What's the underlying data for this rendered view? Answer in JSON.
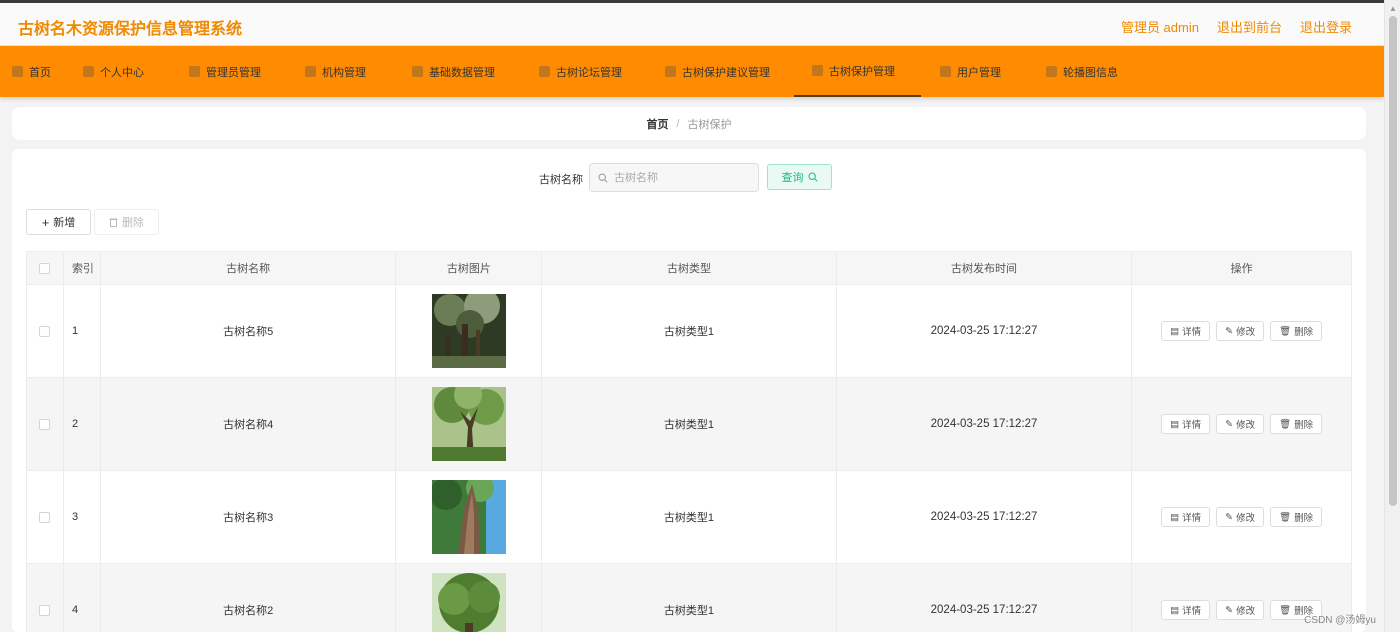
{
  "header": {
    "title": "古树名木资源保护信息管理系统",
    "admin_label": "管理员 admin",
    "front_label": "退出到前台",
    "logout_label": "退出登录"
  },
  "nav": {
    "items": [
      {
        "label": "首页",
        "icon": "home-icon"
      },
      {
        "label": "个人中心",
        "icon": "user-icon"
      },
      {
        "label": "管理员管理",
        "icon": "admin-icon"
      },
      {
        "label": "机构管理",
        "icon": "building-icon"
      },
      {
        "label": "基础数据管理",
        "icon": "data-icon"
      },
      {
        "label": "古树论坛管理",
        "icon": "forum-icon"
      },
      {
        "label": "古树保护建议管理",
        "icon": "suggest-icon"
      },
      {
        "label": "古树保护管理",
        "icon": "protect-icon"
      },
      {
        "label": "用户管理",
        "icon": "users-icon"
      },
      {
        "label": "轮播图信息",
        "icon": "carousel-icon"
      }
    ],
    "active_index": 7
  },
  "breadcrumb": {
    "home": "首页",
    "separator": "/",
    "current": "古树保护"
  },
  "search": {
    "label": "古树名称",
    "placeholder": "古树名称",
    "button": "查询"
  },
  "actions": {
    "add": "新增",
    "delete": "删除"
  },
  "table": {
    "headers": {
      "index": "索引",
      "name": "古树名称",
      "image": "古树图片",
      "type": "古树类型",
      "time": "古树发布时间",
      "ops": "操作"
    },
    "rows": [
      {
        "index": "1",
        "name": "古树名称5",
        "type": "古树类型1",
        "time": "2024-03-25 17:12:27"
      },
      {
        "index": "2",
        "name": "古树名称4",
        "type": "古树类型1",
        "time": "2024-03-25 17:12:27"
      },
      {
        "index": "3",
        "name": "古树名称3",
        "type": "古树类型1",
        "time": "2024-03-25 17:12:27"
      },
      {
        "index": "4",
        "name": "古树名称2",
        "type": "古树类型1",
        "time": "2024-03-25 17:12:27"
      }
    ],
    "op_labels": {
      "detail": "详情",
      "edit": "修改",
      "delete": "删除"
    }
  },
  "watermark": "CSDN @汤姆yu",
  "colors": {
    "brand": "#f08a00",
    "nav_bg": "#ff8c00",
    "search_btn": "#1fb586"
  }
}
